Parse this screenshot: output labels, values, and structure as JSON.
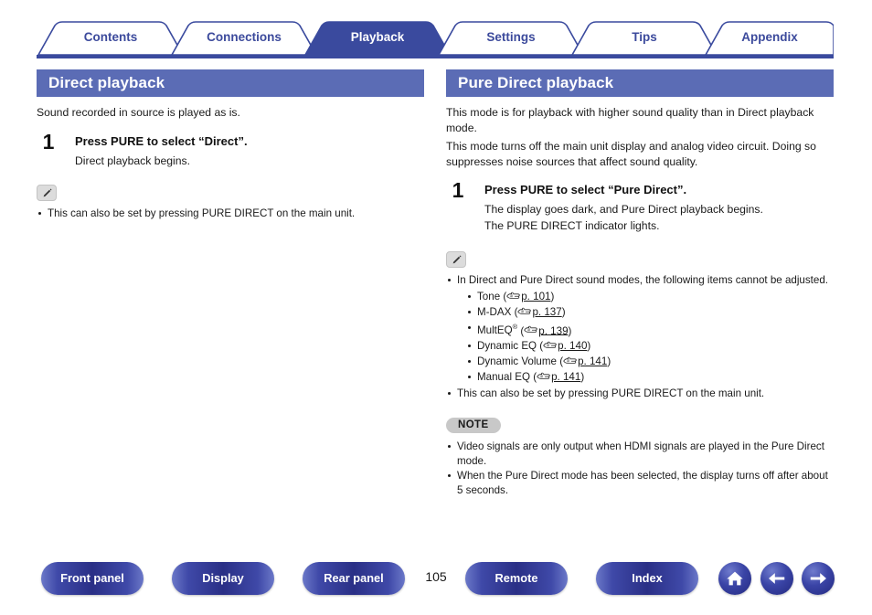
{
  "tabs": [
    {
      "label": "Contents",
      "active": false
    },
    {
      "label": "Connections",
      "active": false
    },
    {
      "label": "Playback",
      "active": true
    },
    {
      "label": "Settings",
      "active": false
    },
    {
      "label": "Tips",
      "active": false
    },
    {
      "label": "Appendix",
      "active": false
    }
  ],
  "colors": {
    "tab_active_bg": "#3a4a9e",
    "tab_inactive_text": "#3c4a9c",
    "section_header_bg": "#5b6cb5",
    "note_pill_bg": "#c8c8c8",
    "button_blue": "#2a2f86"
  },
  "left": {
    "header": "Direct playback",
    "intro": "Sound recorded in source is played as is.",
    "step": {
      "number": "1",
      "title": "Press PURE to select “Direct”.",
      "body": "Direct playback begins."
    },
    "note_icon": "pencil-icon",
    "notes": [
      "This can also be set by pressing PURE DIRECT on the main unit."
    ]
  },
  "right": {
    "header": "Pure Direct playback",
    "intro_1": "This mode is for playback with higher sound quality than in Direct playback mode.",
    "intro_2": "This mode turns off the main unit display and analog video circuit. Doing so suppresses noise sources that affect sound quality.",
    "step": {
      "number": "1",
      "title": "Press PURE to select “Pure Direct”.",
      "body_1": "The display goes dark, and Pure Direct playback begins.",
      "body_2": "The PURE DIRECT indicator lights."
    },
    "note_icon": "pencil-icon",
    "notes_intro": "In Direct and Pure Direct sound modes, the following items cannot be adjusted.",
    "sub_items": [
      {
        "name": "Tone",
        "page": "p. 101"
      },
      {
        "name": "M-DAX",
        "page": "p. 137"
      },
      {
        "name": "MultEQ",
        "page": "p. 139",
        "reg": true
      },
      {
        "name": "Dynamic EQ",
        "page": "p. 140"
      },
      {
        "name": "Dynamic Volume",
        "page": "p. 141"
      },
      {
        "name": "Manual EQ",
        "page": "p. 141"
      }
    ],
    "notes_outro": "This can also be set by pressing PURE DIRECT on the main unit.",
    "note_badge": "NOTE",
    "note_warnings": [
      "Video signals are only output when HDMI signals are played in the Pure Direct mode.",
      "When the Pure Direct mode has been selected, the display turns off after about 5 seconds."
    ]
  },
  "bottom_nav": {
    "page_number": "105",
    "buttons": [
      {
        "label": "Front panel"
      },
      {
        "label": "Display"
      },
      {
        "label": "Rear panel"
      },
      {
        "label": "Remote"
      },
      {
        "label": "Index"
      }
    ],
    "icons": [
      {
        "name": "home-icon"
      },
      {
        "name": "arrow-left-icon"
      },
      {
        "name": "arrow-right-icon"
      }
    ]
  }
}
